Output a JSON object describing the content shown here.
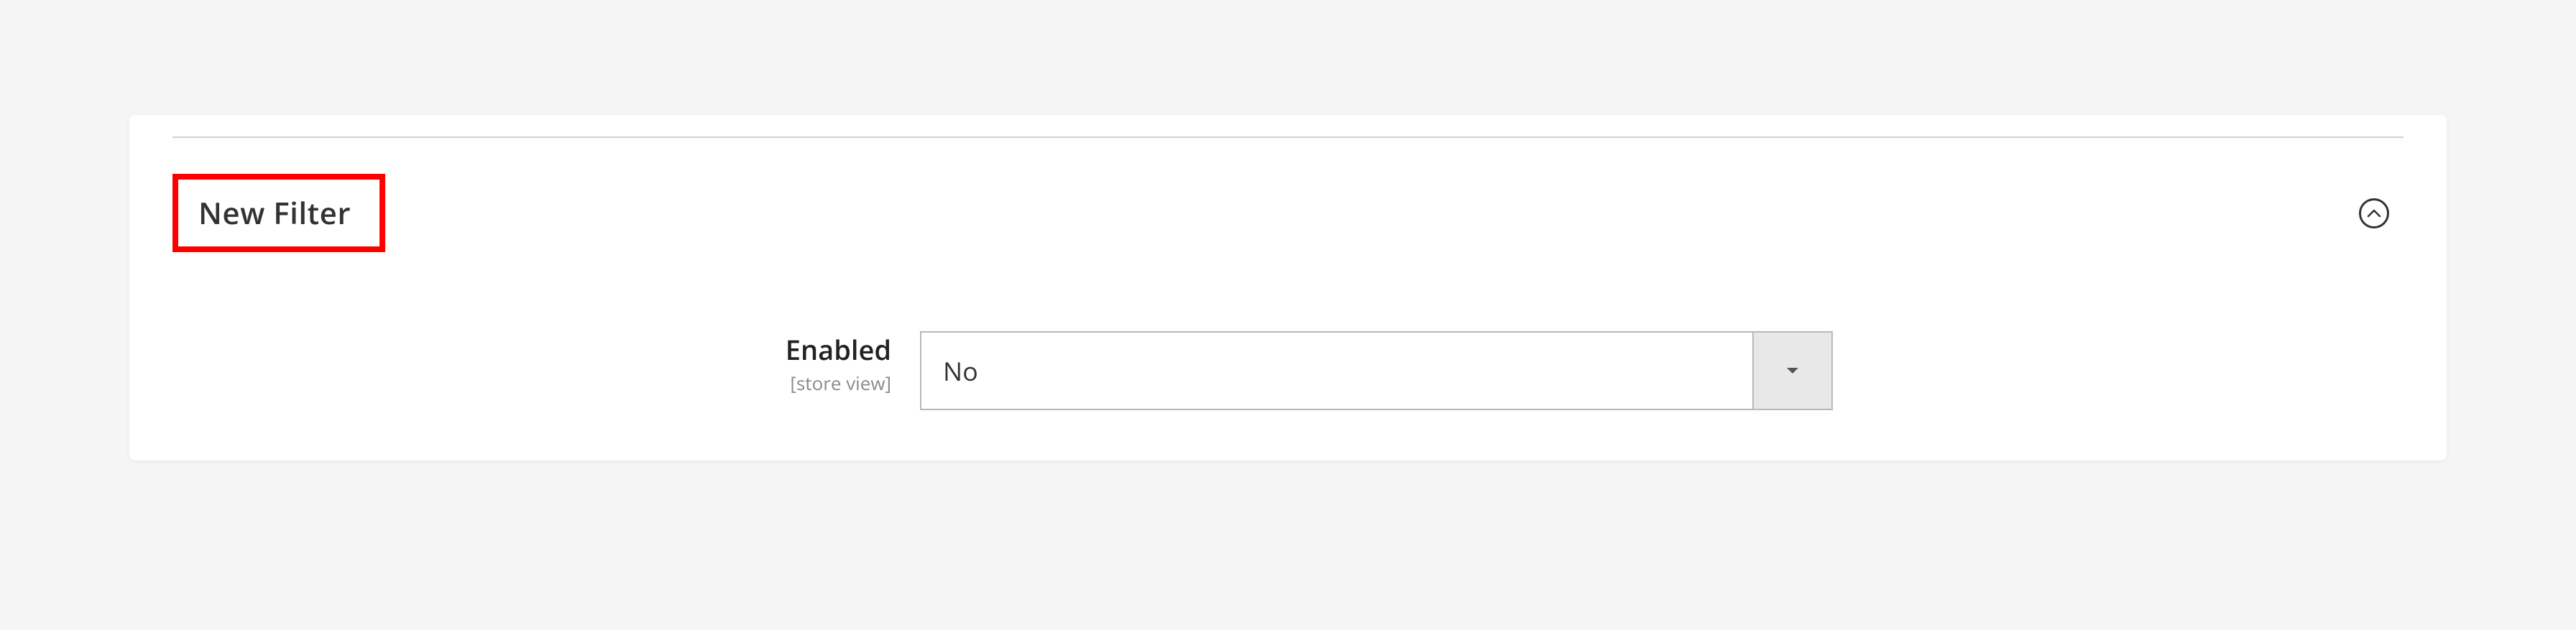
{
  "section": {
    "title": "New Filter"
  },
  "fields": {
    "enabled": {
      "label": "Enabled",
      "scope": "[store view]",
      "value": "No"
    }
  }
}
